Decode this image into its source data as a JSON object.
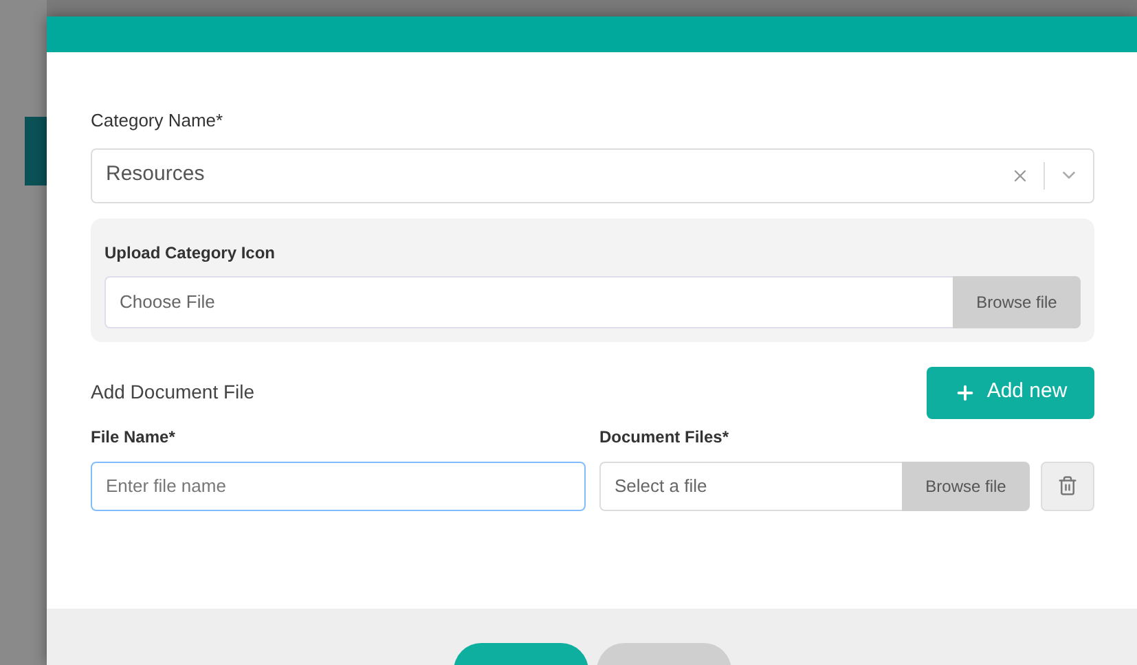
{
  "category": {
    "label": "Category Name*",
    "value": "Resources"
  },
  "upload": {
    "label": "Upload Category Icon",
    "placeholder": "Choose File",
    "browse": "Browse file"
  },
  "documents": {
    "heading": "Add Document File",
    "add_button": "Add new",
    "file_name": {
      "label": "File Name*",
      "placeholder": "Enter file name",
      "focused": true
    },
    "document_files": {
      "label": "Document Files*",
      "placeholder": "Select a file",
      "browse": "Browse file"
    }
  },
  "footer": {
    "buttons": [
      {
        "kind": "primary"
      },
      {
        "kind": "secondary"
      }
    ]
  }
}
